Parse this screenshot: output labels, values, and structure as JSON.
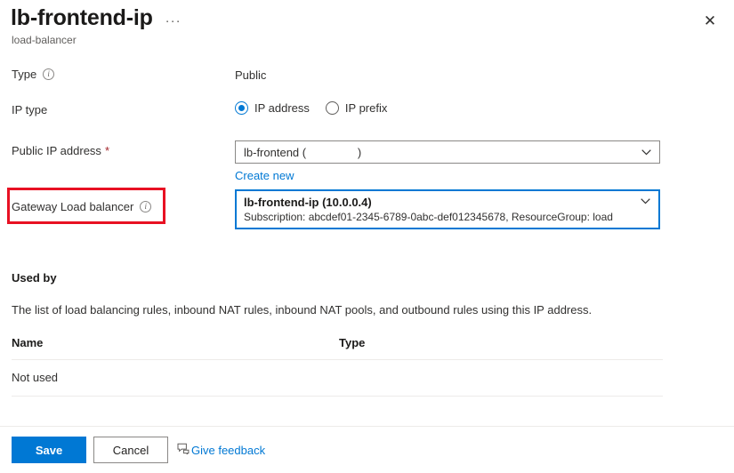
{
  "header": {
    "title": "lb-frontend-ip",
    "subtitle": "load-balancer",
    "more_menu": "···",
    "close_label": "✕"
  },
  "form": {
    "type": {
      "label": "Type",
      "info_glyph": "i",
      "value": "Public"
    },
    "ip_type": {
      "label": "IP type",
      "options": [
        {
          "label": "IP address",
          "selected": true
        },
        {
          "label": "IP prefix",
          "selected": false
        }
      ]
    },
    "public_ip_address": {
      "label": "Public IP address",
      "required_marker": "*",
      "selected_value": "lb-frontend (                )",
      "create_new_label": "Create new"
    },
    "gateway_load_balancer": {
      "label": "Gateway Load balancer",
      "info_glyph": "i",
      "selected_title": "lb-frontend-ip (10.0.0.4)",
      "selected_subtitle": "Subscription: abcdef01-2345-6789-0abc-def012345678, ResourceGroup: load",
      "highlight_color": "#e81123"
    }
  },
  "used_by": {
    "title": "Used by",
    "description": "The list of load balancing rules, inbound NAT rules, inbound NAT pools, and outbound rules using this IP address.",
    "columns": [
      "Name",
      "Type"
    ],
    "rows": [
      {
        "name": "Not used",
        "type": ""
      }
    ]
  },
  "footer": {
    "save_label": "Save",
    "cancel_label": "Cancel",
    "feedback_label": "Give feedback"
  },
  "colors": {
    "accent": "#0078d4",
    "required": "#a4262c",
    "highlight": "#e81123"
  }
}
